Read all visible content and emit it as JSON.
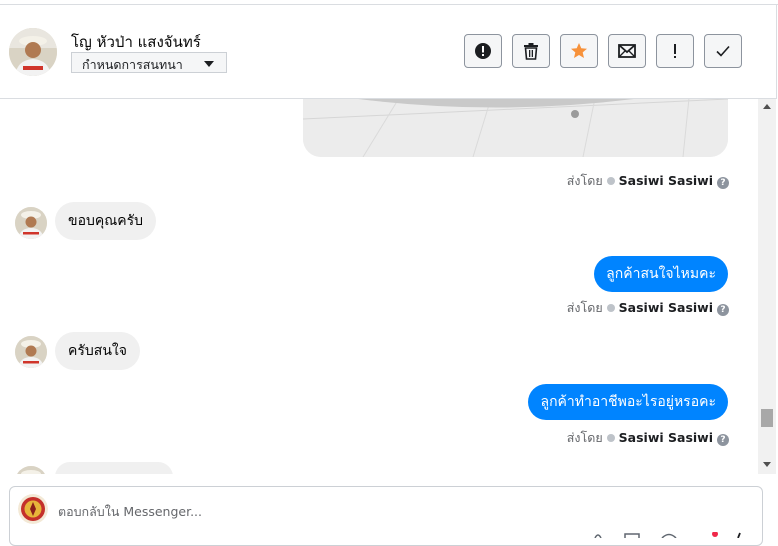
{
  "header": {
    "contact_name": "โญ หัวป่า แสงจันทร์",
    "assign_select": "กำหนดการสนทนา",
    "toolbar": [
      {
        "name": "report-spam-button",
        "icon": "exclamation-circle-icon"
      },
      {
        "name": "delete-button",
        "icon": "trash-icon"
      },
      {
        "name": "star-button",
        "icon": "star-icon"
      },
      {
        "name": "mark-unread-button",
        "icon": "envelope-icon"
      },
      {
        "name": "flag-button",
        "icon": "exclamation-icon"
      },
      {
        "name": "mark-done-button",
        "icon": "checkmark-icon"
      }
    ]
  },
  "thread": {
    "sent_by_label": "ส่งโดย",
    "sender": "Sasiwi Sasiwi",
    "help_glyph": "?",
    "messages": [
      {
        "from": "contact",
        "text": "ขอบคุณครับ"
      },
      {
        "from": "page",
        "text": "ลูกค้าสนใจไหมคะ"
      },
      {
        "from": "contact",
        "text": "ครับสนใจ"
      },
      {
        "from": "page",
        "text": "ลูกค้าทำอาชีพอะไรอยู่หรอคะ"
      }
    ]
  },
  "reply": {
    "placeholder": "ตอบกลับใน Messenger..."
  },
  "colors": {
    "accent": "#0084ff",
    "incoming_bubble": "#f0f0f0",
    "star": "#f7923b",
    "notification_dot": "#f02849"
  }
}
